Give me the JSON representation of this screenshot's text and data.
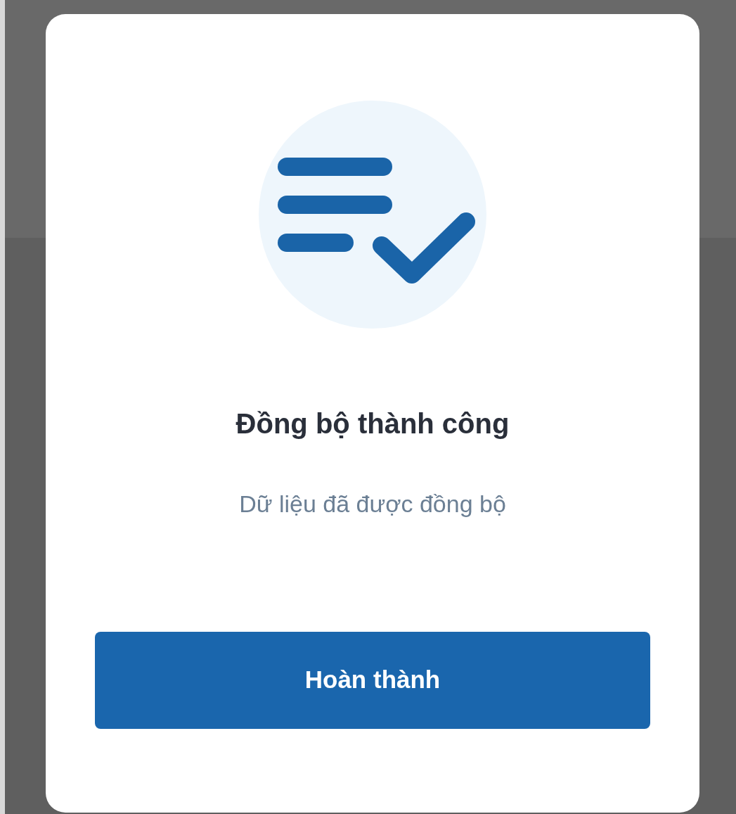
{
  "dialog": {
    "title": "Đồng bộ thành công",
    "message": "Dữ liệu đã được đồng bộ",
    "button": "Hoàn thành"
  }
}
